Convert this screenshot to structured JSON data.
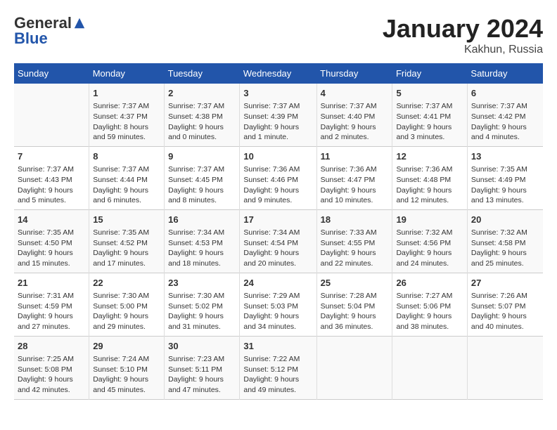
{
  "header": {
    "logo_general": "General",
    "logo_blue": "Blue",
    "month": "January 2024",
    "location": "Kakhun, Russia"
  },
  "days_of_week": [
    "Sunday",
    "Monday",
    "Tuesday",
    "Wednesday",
    "Thursday",
    "Friday",
    "Saturday"
  ],
  "weeks": [
    [
      {
        "day": "",
        "sunrise": "",
        "sunset": "",
        "daylight": ""
      },
      {
        "day": "1",
        "sunrise": "Sunrise: 7:37 AM",
        "sunset": "Sunset: 4:37 PM",
        "daylight": "Daylight: 8 hours and 59 minutes."
      },
      {
        "day": "2",
        "sunrise": "Sunrise: 7:37 AM",
        "sunset": "Sunset: 4:38 PM",
        "daylight": "Daylight: 9 hours and 0 minutes."
      },
      {
        "day": "3",
        "sunrise": "Sunrise: 7:37 AM",
        "sunset": "Sunset: 4:39 PM",
        "daylight": "Daylight: 9 hours and 1 minute."
      },
      {
        "day": "4",
        "sunrise": "Sunrise: 7:37 AM",
        "sunset": "Sunset: 4:40 PM",
        "daylight": "Daylight: 9 hours and 2 minutes."
      },
      {
        "day": "5",
        "sunrise": "Sunrise: 7:37 AM",
        "sunset": "Sunset: 4:41 PM",
        "daylight": "Daylight: 9 hours and 3 minutes."
      },
      {
        "day": "6",
        "sunrise": "Sunrise: 7:37 AM",
        "sunset": "Sunset: 4:42 PM",
        "daylight": "Daylight: 9 hours and 4 minutes."
      }
    ],
    [
      {
        "day": "7",
        "sunrise": "Sunrise: 7:37 AM",
        "sunset": "Sunset: 4:43 PM",
        "daylight": "Daylight: 9 hours and 5 minutes."
      },
      {
        "day": "8",
        "sunrise": "Sunrise: 7:37 AM",
        "sunset": "Sunset: 4:44 PM",
        "daylight": "Daylight: 9 hours and 6 minutes."
      },
      {
        "day": "9",
        "sunrise": "Sunrise: 7:37 AM",
        "sunset": "Sunset: 4:45 PM",
        "daylight": "Daylight: 9 hours and 8 minutes."
      },
      {
        "day": "10",
        "sunrise": "Sunrise: 7:36 AM",
        "sunset": "Sunset: 4:46 PM",
        "daylight": "Daylight: 9 hours and 9 minutes."
      },
      {
        "day": "11",
        "sunrise": "Sunrise: 7:36 AM",
        "sunset": "Sunset: 4:47 PM",
        "daylight": "Daylight: 9 hours and 10 minutes."
      },
      {
        "day": "12",
        "sunrise": "Sunrise: 7:36 AM",
        "sunset": "Sunset: 4:48 PM",
        "daylight": "Daylight: 9 hours and 12 minutes."
      },
      {
        "day": "13",
        "sunrise": "Sunrise: 7:35 AM",
        "sunset": "Sunset: 4:49 PM",
        "daylight": "Daylight: 9 hours and 13 minutes."
      }
    ],
    [
      {
        "day": "14",
        "sunrise": "Sunrise: 7:35 AM",
        "sunset": "Sunset: 4:50 PM",
        "daylight": "Daylight: 9 hours and 15 minutes."
      },
      {
        "day": "15",
        "sunrise": "Sunrise: 7:35 AM",
        "sunset": "Sunset: 4:52 PM",
        "daylight": "Daylight: 9 hours and 17 minutes."
      },
      {
        "day": "16",
        "sunrise": "Sunrise: 7:34 AM",
        "sunset": "Sunset: 4:53 PM",
        "daylight": "Daylight: 9 hours and 18 minutes."
      },
      {
        "day": "17",
        "sunrise": "Sunrise: 7:34 AM",
        "sunset": "Sunset: 4:54 PM",
        "daylight": "Daylight: 9 hours and 20 minutes."
      },
      {
        "day": "18",
        "sunrise": "Sunrise: 7:33 AM",
        "sunset": "Sunset: 4:55 PM",
        "daylight": "Daylight: 9 hours and 22 minutes."
      },
      {
        "day": "19",
        "sunrise": "Sunrise: 7:32 AM",
        "sunset": "Sunset: 4:56 PM",
        "daylight": "Daylight: 9 hours and 24 minutes."
      },
      {
        "day": "20",
        "sunrise": "Sunrise: 7:32 AM",
        "sunset": "Sunset: 4:58 PM",
        "daylight": "Daylight: 9 hours and 25 minutes."
      }
    ],
    [
      {
        "day": "21",
        "sunrise": "Sunrise: 7:31 AM",
        "sunset": "Sunset: 4:59 PM",
        "daylight": "Daylight: 9 hours and 27 minutes."
      },
      {
        "day": "22",
        "sunrise": "Sunrise: 7:30 AM",
        "sunset": "Sunset: 5:00 PM",
        "daylight": "Daylight: 9 hours and 29 minutes."
      },
      {
        "day": "23",
        "sunrise": "Sunrise: 7:30 AM",
        "sunset": "Sunset: 5:02 PM",
        "daylight": "Daylight: 9 hours and 31 minutes."
      },
      {
        "day": "24",
        "sunrise": "Sunrise: 7:29 AM",
        "sunset": "Sunset: 5:03 PM",
        "daylight": "Daylight: 9 hours and 34 minutes."
      },
      {
        "day": "25",
        "sunrise": "Sunrise: 7:28 AM",
        "sunset": "Sunset: 5:04 PM",
        "daylight": "Daylight: 9 hours and 36 minutes."
      },
      {
        "day": "26",
        "sunrise": "Sunrise: 7:27 AM",
        "sunset": "Sunset: 5:06 PM",
        "daylight": "Daylight: 9 hours and 38 minutes."
      },
      {
        "day": "27",
        "sunrise": "Sunrise: 7:26 AM",
        "sunset": "Sunset: 5:07 PM",
        "daylight": "Daylight: 9 hours and 40 minutes."
      }
    ],
    [
      {
        "day": "28",
        "sunrise": "Sunrise: 7:25 AM",
        "sunset": "Sunset: 5:08 PM",
        "daylight": "Daylight: 9 hours and 42 minutes."
      },
      {
        "day": "29",
        "sunrise": "Sunrise: 7:24 AM",
        "sunset": "Sunset: 5:10 PM",
        "daylight": "Daylight: 9 hours and 45 minutes."
      },
      {
        "day": "30",
        "sunrise": "Sunrise: 7:23 AM",
        "sunset": "Sunset: 5:11 PM",
        "daylight": "Daylight: 9 hours and 47 minutes."
      },
      {
        "day": "31",
        "sunrise": "Sunrise: 7:22 AM",
        "sunset": "Sunset: 5:12 PM",
        "daylight": "Daylight: 9 hours and 49 minutes."
      },
      {
        "day": "",
        "sunrise": "",
        "sunset": "",
        "daylight": ""
      },
      {
        "day": "",
        "sunrise": "",
        "sunset": "",
        "daylight": ""
      },
      {
        "day": "",
        "sunrise": "",
        "sunset": "",
        "daylight": ""
      }
    ]
  ]
}
